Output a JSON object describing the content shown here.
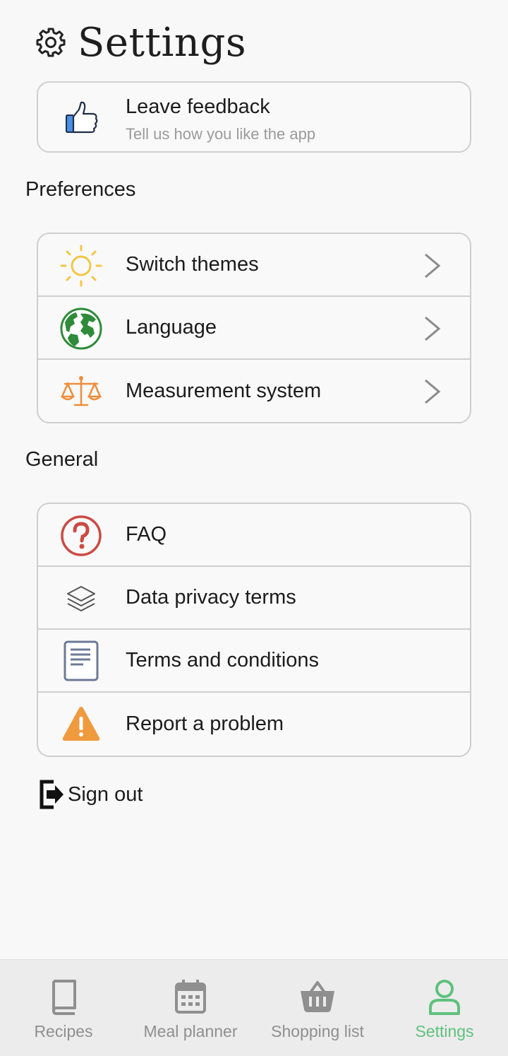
{
  "header": {
    "title": "Settings",
    "icon": "gear-icon"
  },
  "feedback": {
    "title": "Leave feedback",
    "subtitle": "Tell us how you like the app",
    "icon": "thumbs-up-icon"
  },
  "preferences": {
    "section_title": "Preferences",
    "items": [
      {
        "label": "Switch themes",
        "icon": "sun-icon"
      },
      {
        "label": "Language",
        "icon": "globe-icon"
      },
      {
        "label": "Measurement system",
        "icon": "scale-icon"
      }
    ]
  },
  "general": {
    "section_title": "General",
    "items": [
      {
        "label": "FAQ",
        "icon": "question-icon"
      },
      {
        "label": "Data privacy terms",
        "icon": "layers-icon"
      },
      {
        "label": "Terms and conditions",
        "icon": "document-icon"
      },
      {
        "label": "Report a problem",
        "icon": "warning-icon"
      }
    ]
  },
  "signout": {
    "label": "Sign out",
    "icon": "sign-out-icon"
  },
  "bottom_nav": {
    "active": "Settings",
    "active_color": "#5fc17e",
    "inactive_color": "#8f8f8f",
    "items": [
      {
        "label": "Recipes",
        "icon": "book-icon"
      },
      {
        "label": "Meal planner",
        "icon": "calendar-icon"
      },
      {
        "label": "Shopping list",
        "icon": "basket-icon"
      },
      {
        "label": "Settings",
        "icon": "user-icon"
      }
    ]
  },
  "colors": {
    "sun": "#f2c744",
    "globe": "#2e8b3a",
    "scale": "#ef8d3a",
    "question": "#cc4a44",
    "document": "#6d7a96",
    "warning": "#f09a3e",
    "thumb": "#4a8ee6"
  }
}
